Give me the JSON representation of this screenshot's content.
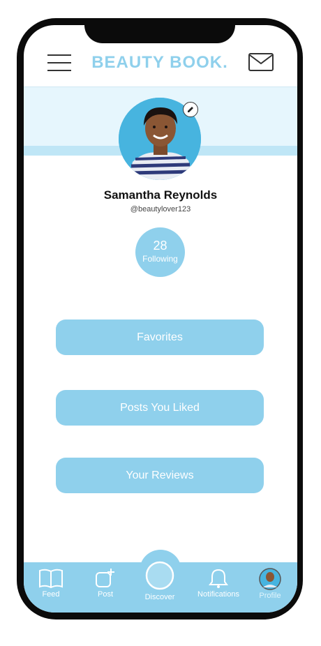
{
  "header": {
    "logo": "BEAUTY BOOK."
  },
  "profile": {
    "name": "Samantha Reynolds",
    "handle": "@beautylover123",
    "following_count": "28",
    "following_label": "Following"
  },
  "actions": [
    {
      "label": "Favorites"
    },
    {
      "label": "Posts You Liked"
    },
    {
      "label": "Your Reviews"
    }
  ],
  "nav": {
    "items": [
      {
        "label": "Feed",
        "icon": "book-icon"
      },
      {
        "label": "Post",
        "icon": "add-post-icon"
      },
      {
        "label": "Discover",
        "icon": "discover-icon"
      },
      {
        "label": "Notifications",
        "icon": "bell-icon"
      },
      {
        "label": "Profile",
        "icon": "avatar-icon"
      }
    ]
  },
  "colors": {
    "accent": "#8fd0ec",
    "banner": "#e6f6fd",
    "text": "#111111"
  }
}
